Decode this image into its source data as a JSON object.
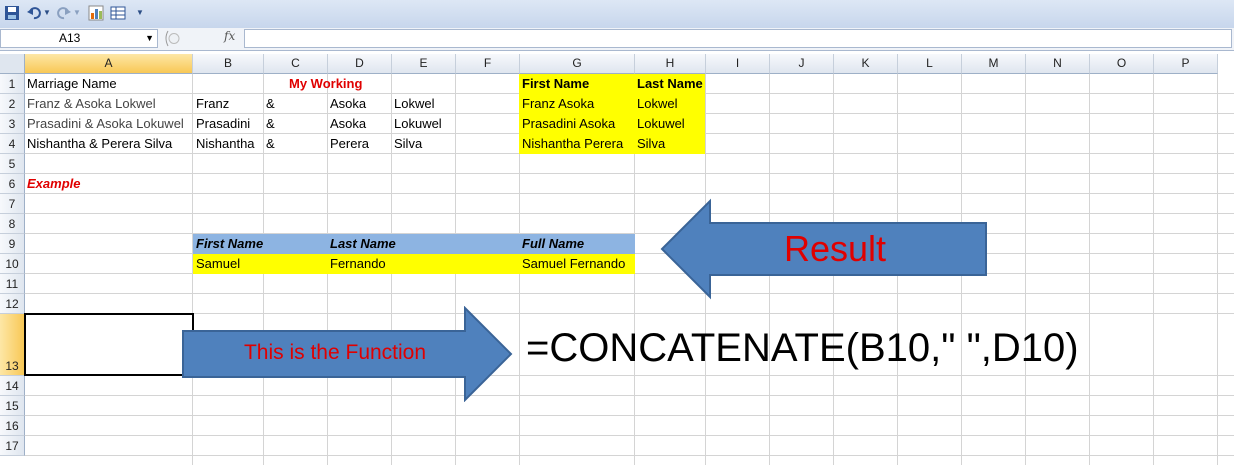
{
  "toolbar": {
    "icons": [
      "save-icon",
      "undo-icon",
      "dropdown-icon",
      "redo-icon",
      "dropdown-icon",
      "chart-icon",
      "table-icon",
      "customize-icon"
    ]
  },
  "formula_bar": {
    "name_box": "A13",
    "fx_label": "fx",
    "formula": ""
  },
  "columns": [
    "A",
    "B",
    "C",
    "D",
    "E",
    "F",
    "G",
    "H",
    "I",
    "J",
    "K",
    "L",
    "M",
    "N",
    "O",
    "P"
  ],
  "selected_column": "A",
  "rows": [
    "1",
    "2",
    "3",
    "4",
    "5",
    "6",
    "7",
    "8",
    "9",
    "10",
    "11",
    "12",
    "13",
    "14",
    "15",
    "16",
    "17"
  ],
  "selected_row": "13",
  "cells": {
    "A1": "Marriage Name",
    "C1": "My Working",
    "G1": "First Name",
    "H1": "Last Name",
    "A2": "Franz & Asoka Lokwel",
    "B2": "Franz",
    "C2": "&",
    "D2": "Asoka",
    "E2": "Lokwel",
    "G2": "Franz Asoka",
    "H2": "Lokwel",
    "A3": "Prasadini & Asoka Lokuwel",
    "B3": "Prasadini",
    "C3": "&",
    "D3": "Asoka",
    "E3": "Lokuwel",
    "G3": "Prasadini Asoka",
    "H3": "Lokuwel",
    "A4": "Nishantha & Perera Silva",
    "B4": "Nishantha",
    "C4": "&",
    "D4": "Perera",
    "E4": "Silva",
    "G4": "Nishantha Perera",
    "H4": "Silva",
    "A6": "Example",
    "B9": "First Name",
    "D9": "Last Name",
    "G9": "Full Name",
    "B10": "Samuel",
    "D10": "Fernando",
    "G10": "Samuel Fernando"
  },
  "annotations": {
    "result_arrow": "Result",
    "function_arrow": "This is the Function",
    "function_text": "=CONCATENATE(B10,\" \",D10)"
  },
  "colors": {
    "highlight_yellow": "#ffff00",
    "header_blue": "#8db4e2",
    "arrow_blue": "#4f81bd",
    "red_text": "#e00000"
  }
}
